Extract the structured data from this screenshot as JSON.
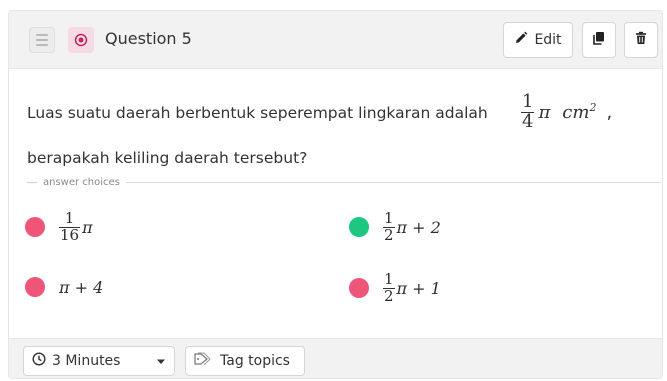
{
  "header": {
    "title": "Question 5",
    "edit_label": "Edit",
    "drag_icon": "drag-handle-icon",
    "type_icon": "radio-target-icon",
    "edit_icon": "pencil-icon",
    "duplicate_icon": "copy-icon",
    "delete_icon": "trash-icon"
  },
  "question": {
    "line1": "Luas suatu daerah berbentuk seperempat lingkaran adalah",
    "formula_num": "1",
    "formula_den": "4",
    "formula_pi": "π",
    "formula_unit": "cm",
    "formula_exp": "2",
    "formula_trailing": ",",
    "line2": "berapakah keliling daerah tersebut?"
  },
  "answer_choices_label": "answer choices",
  "choices": [
    {
      "num": "1",
      "den": "16",
      "suffix": "π",
      "prefix": "",
      "color": "#ee5576",
      "correct": false
    },
    {
      "num": "1",
      "den": "2",
      "suffix": "π + 2",
      "prefix": "",
      "color": "#1ec77f",
      "correct": true
    },
    {
      "text": "π + 4",
      "color": "#ee5576",
      "correct": false
    },
    {
      "num": "1",
      "den": "2",
      "suffix": "π + 1",
      "prefix": "",
      "color": "#ee5576",
      "correct": false
    }
  ],
  "footer": {
    "time_label": "3 Minutes",
    "clock_icon": "clock-icon",
    "caret_icon": "caret-down-icon",
    "tag_label": "Tag topics",
    "tag_icon": "tag-icon"
  },
  "colors": {
    "incorrect": "#ee5576",
    "correct": "#1ec77f",
    "type_badge_bg": "#f6dbe5",
    "type_badge_fg": "#c0265d",
    "header_bg": "#f2f2f2"
  }
}
